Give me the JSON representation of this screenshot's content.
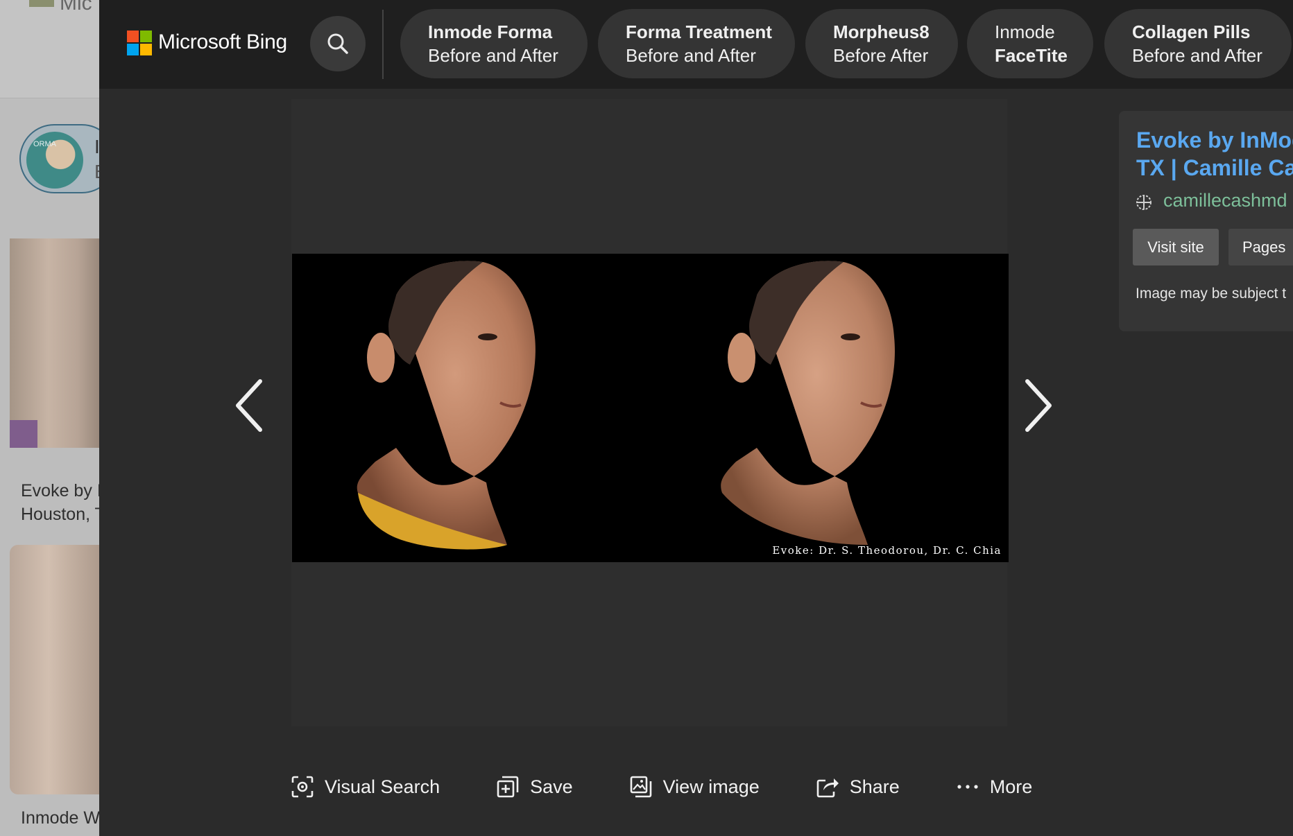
{
  "background_page": {
    "logo_fragment": "Mic",
    "chip_letter": "I",
    "chip_letter2": "E",
    "chip_avatar_text": "ORMA",
    "captions": [
      "Evoke by I",
      "Houston, T",
      "Inmode W"
    ]
  },
  "header": {
    "brand": "Microsoft Bing",
    "related_searches": [
      {
        "line1": "Inmode Forma",
        "line2": "Before and After",
        "bold_line": 1
      },
      {
        "line1": "Forma Treatment",
        "line2": "Before and After",
        "bold_line": 1
      },
      {
        "line1": "Morpheus8",
        "line2": "Before After",
        "bold_line": 1
      },
      {
        "line1": "Inmode",
        "line2": "FaceTite",
        "bold_line": 2
      },
      {
        "line1": "Collagen Pills",
        "line2": "Before and After",
        "bold_line": 1
      }
    ]
  },
  "viewer": {
    "image_credit": "Evoke: Dr. S. Theodorou, Dr. C. Chia",
    "prev_label": "Previous image",
    "next_label": "Next image"
  },
  "info_panel": {
    "title_line1": "Evoke by InMod",
    "title_line2": "TX | Camille Cas",
    "domain": "camillecashmd",
    "visit_label": "Visit site",
    "pages_label": "Pages",
    "note": "Image may be subject t"
  },
  "actions": {
    "visual_search": "Visual Search",
    "save": "Save",
    "view_image": "View image",
    "share": "Share",
    "more": "More"
  }
}
